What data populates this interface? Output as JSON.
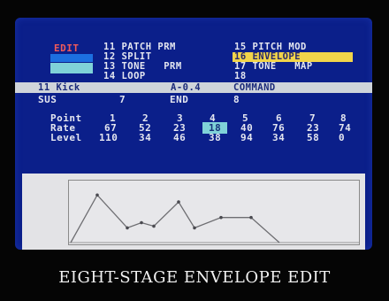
{
  "screen": {
    "edit_tag": {
      "label": "EDIT",
      "label_color": "#f05a5a",
      "block_colors": [
        "#1c6fe0",
        "#7fd2d8"
      ]
    },
    "menu_left": [
      {
        "label": "11 PATCH PRM"
      },
      {
        "label": "12 SPLIT"
      },
      {
        "label": "13 TONE   PRM"
      },
      {
        "label": "14 LOOP"
      }
    ],
    "menu_right": [
      {
        "label": "15 PITCH MOD",
        "selected": false
      },
      {
        "label": "16 ENVELOPE",
        "selected": true
      },
      {
        "label": "17 TONE   MAP",
        "selected": false
      },
      {
        "label": "18",
        "selected": false
      }
    ],
    "status_bar": {
      "tone_name": "11 Kick",
      "note": "A-0.4",
      "mode": "COMMAND"
    },
    "sus_row": {
      "sus_label": "SUS",
      "sus_value": "7",
      "end_label": "END",
      "end_value": "8"
    },
    "envelope_table": {
      "row_labels": [
        "Point",
        "Rate",
        "Level"
      ],
      "points": [
        "1",
        "2",
        "3",
        "4",
        "5",
        "6",
        "7",
        "8"
      ],
      "rates": [
        "67",
        "52",
        "23",
        "18",
        "40",
        "76",
        "23",
        "74"
      ],
      "levels": [
        "110",
        "34",
        "46",
        "38",
        "94",
        "34",
        "58",
        "0"
      ],
      "selected_point_index": 3,
      "selected_color": "#7fd2d8"
    },
    "graph_levels": [
      0,
      110,
      34,
      46,
      38,
      94,
      34,
      58,
      58,
      0
    ],
    "level_max": 127
  },
  "caption": "EIGHT-STAGE ENVELOPE EDIT"
}
